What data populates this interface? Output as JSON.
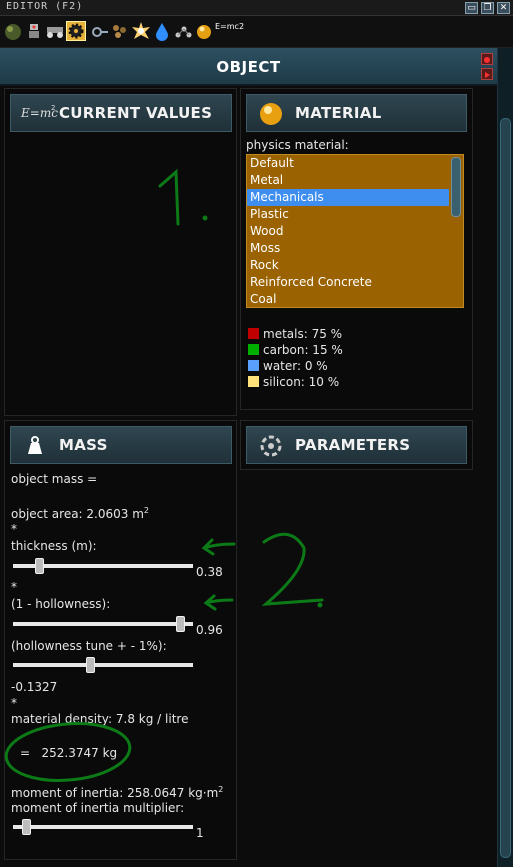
{
  "window": {
    "title": "EDITOR (F2)"
  },
  "toolbar": {
    "tools": [
      {
        "icon": "planet-icon"
      },
      {
        "icon": "robot-icon"
      },
      {
        "icon": "vehicle-icon"
      },
      {
        "icon": "gear-icon",
        "active": true
      },
      {
        "icon": "joint-icon"
      },
      {
        "icon": "rocks-icon"
      },
      {
        "icon": "explosion-icon"
      },
      {
        "icon": "water-drop-icon"
      },
      {
        "icon": "molecules-icon"
      },
      {
        "icon": "sphere-icon"
      },
      {
        "icon": "formula-icon",
        "label": "E=mc2"
      }
    ]
  },
  "header": {
    "title": "OBJECT"
  },
  "current_values": {
    "title": "CURRENT VALUES",
    "icon_label": "E=mc"
  },
  "material": {
    "title": "MATERIAL",
    "label": "physics material:",
    "options": [
      "Default",
      "Metal",
      "Mechanicals",
      "Plastic",
      "Wood",
      "Moss",
      "Rock",
      "Reinforced Concrete",
      "Coal"
    ],
    "selected": "Mechanicals",
    "composition": [
      {
        "label": "metals: 75 %",
        "color": "#c00000"
      },
      {
        "label": "carbon: 15 %",
        "color": "#00b000"
      },
      {
        "label": "water: 0 %",
        "color": "#5aa0ff"
      },
      {
        "label": "silicon: 10 %",
        "color": "#ffe27a"
      }
    ]
  },
  "mass": {
    "title": "MASS",
    "object_mass": "object mass =",
    "object_area": "object area: 2.0603 m",
    "area_exp": "2",
    "star": "*",
    "thickness_label": "thickness (m):",
    "thickness_value": "0.38",
    "thickness_fraction": 0.13,
    "hollowness_label": "(1 - hollowness):",
    "hollowness_value": "0.96",
    "hollowness_fraction": 0.96,
    "tune_label": "(hollowness tune + - 1%):",
    "tune_value": "-0.1327",
    "tune_fraction": 0.43,
    "density": "material density: 7.8 kg / litre",
    "result": "=   252.3747 kg",
    "inertia": "moment of inertia: 258.0647 kg·m",
    "inertia_exp": "2",
    "inertia_mult_label": "moment of inertia multiplier:",
    "inertia_mult_value": "1",
    "inertia_mult_fraction": 0.05
  },
  "parameters": {
    "title": "PARAMETERS"
  },
  "annotations": {
    "one": "1.",
    "two": "2."
  }
}
